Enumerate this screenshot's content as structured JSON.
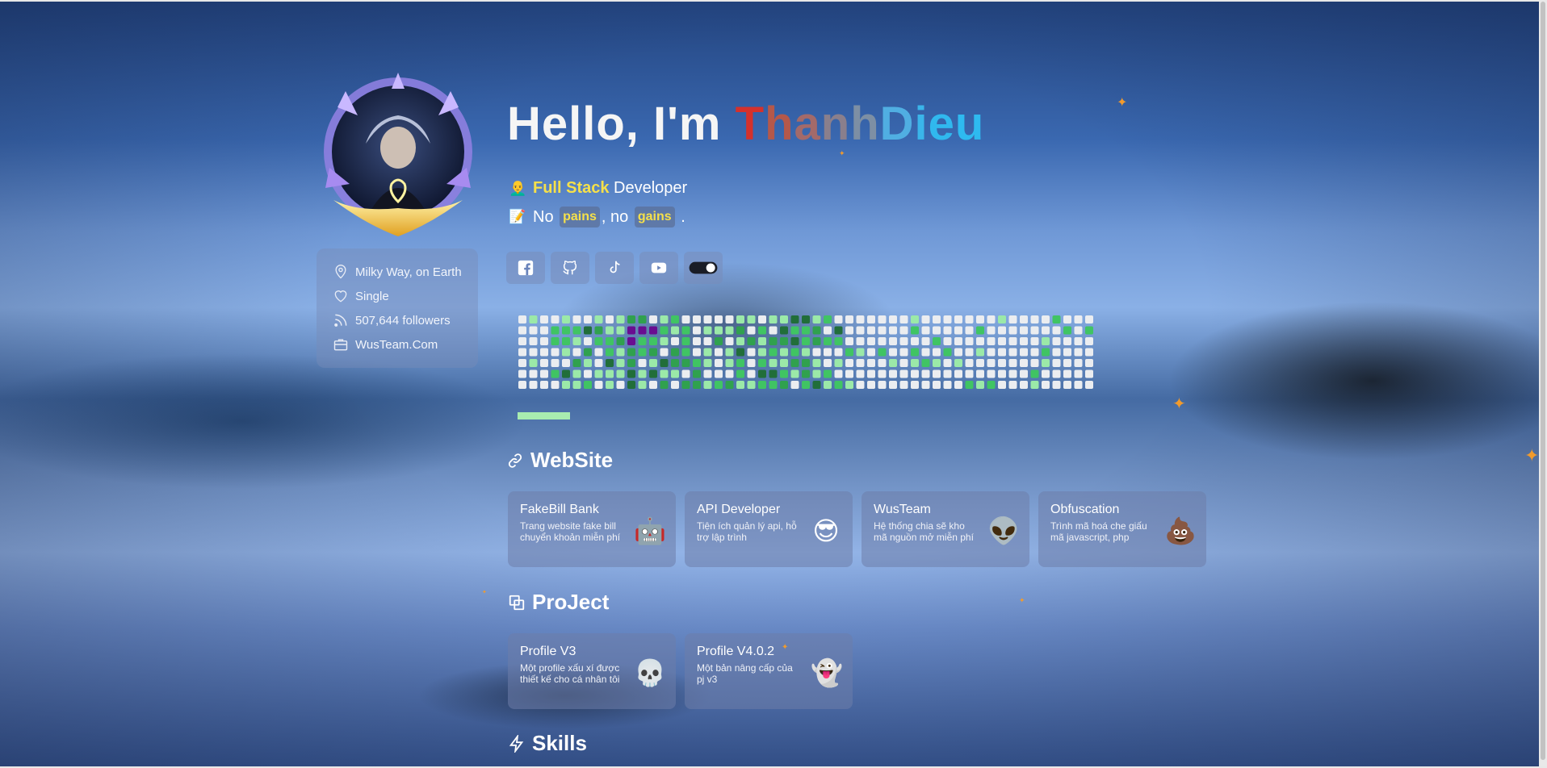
{
  "profile": {
    "greeting": "Hello, I'm ",
    "name_letters": [
      {
        "ch": "T",
        "color": "#d4312c"
      },
      {
        "ch": "h",
        "color": "#b5584a"
      },
      {
        "ch": "a",
        "color": "#a36a6a"
      },
      {
        "ch": "n",
        "color": "#8a7f8c"
      },
      {
        "ch": "h",
        "color": "#7d8fa4"
      },
      {
        "ch": "D",
        "color": "#50aee2"
      },
      {
        "ch": "i",
        "color": "#3ab5ea"
      },
      {
        "ch": "e",
        "color": "#30b8ee"
      },
      {
        "ch": "u",
        "color": "#2ebaf0"
      }
    ],
    "role_emoji": "👨‍🦲",
    "role_highlight": "Full Stack",
    "role_rest": " Developer",
    "quote_emoji": "📝",
    "quote_prefix": "No ",
    "quote_tag1": "pains",
    "quote_mid": ", no ",
    "quote_tag2": "gains",
    "quote_suffix": " ."
  },
  "info": {
    "location": "Milky Way, on Earth",
    "status": "Single",
    "followers": "507,644 followers",
    "company": "WusTeam.Com"
  },
  "socials": [
    {
      "name": "facebook-icon"
    },
    {
      "name": "github-icon"
    },
    {
      "name": "tiktok-icon"
    },
    {
      "name": "youtube-icon"
    },
    {
      "name": "theme-toggle-icon"
    }
  ],
  "contributions": {
    "weeks": 53,
    "days": 7,
    "colors": [
      "#ebedf0",
      "#9be9a8",
      "#40c463",
      "#30a14e",
      "#216e39",
      "#6a0d91"
    ]
  },
  "sections": {
    "website": "WebSite",
    "project": "ProJect",
    "skills": "Skills"
  },
  "website_cards": [
    {
      "title": "FakeBill Bank",
      "desc": "Trang website fake bill chuyển khoản miễn phí",
      "emoji": "🤖"
    },
    {
      "title": "API Developer",
      "desc": "Tiện ích quản lý api, hỗ trợ lập trình",
      "emoji": "😎"
    },
    {
      "title": "WusTeam",
      "desc": "Hệ thống chia sẽ kho mã nguồn mở miễn phí",
      "emoji": "👽"
    },
    {
      "title": "Obfuscation",
      "desc": "Trình mã hoá che giấu mã javascript, php",
      "emoji": "💩"
    }
  ],
  "project_cards": [
    {
      "title": "Profile V3",
      "desc": "Một profile xấu xí được thiết kế cho cá nhân tôi",
      "emoji": "💀"
    },
    {
      "title": "Profile V4.0.2",
      "desc": "Một bản nâng cấp của pj v3",
      "emoji": "👻"
    }
  ],
  "colors": {
    "accent_yellow": "#f5e04a",
    "card_bg": "rgba(110,125,170,0.55)"
  }
}
